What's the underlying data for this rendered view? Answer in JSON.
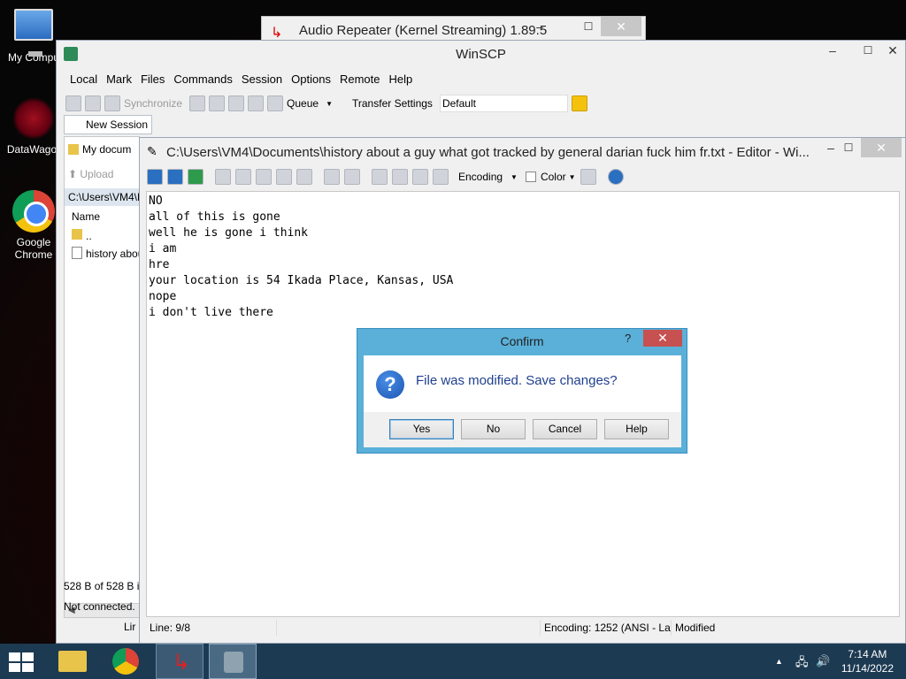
{
  "desktop": {
    "icons": [
      {
        "label": "My Compu"
      },
      {
        "label": "DataWagor"
      },
      {
        "label": "Google\nChrome"
      }
    ]
  },
  "audio_window": {
    "title": "Audio Repeater (Kernel Streaming) 1.89.5",
    "minimize": "–",
    "maximize": "☐",
    "close": "✕"
  },
  "winscp": {
    "title": "WinSCP",
    "minimize": "–",
    "maximize": "☐",
    "close": "✕",
    "menu": [
      "Local",
      "Mark",
      "Files",
      "Commands",
      "Session",
      "Options",
      "Remote",
      "Help"
    ],
    "toolbar": {
      "synchronize": "Synchronize",
      "queue": "Queue",
      "transfer_settings": "Transfer Settings",
      "transfer_value": "Default"
    },
    "new_session_tab": "New Session",
    "left_panel": {
      "location": "My docum",
      "upload": "Upload",
      "path": "C:\\Users\\VM4\\D",
      "column_name": "Name",
      "rows": [
        "..",
        "history abou"
      ]
    },
    "status": {
      "size": "528 B of 528 B ir",
      "connection": "Not connected."
    }
  },
  "editor": {
    "title": "C:\\Users\\VM4\\Documents\\history about a guy what got tracked by general darian fuck him fr.txt - Editor - Wi...",
    "minimize": "–",
    "maximize": "☐",
    "close": "✕",
    "toolbar": {
      "encoding": "Encoding",
      "color": "Color"
    },
    "lines": [
      "NO",
      "all of this is gone",
      "well he is gone i think",
      "i am",
      "hre",
      "your location is 54 Ikada Place, Kansas, USA",
      "nope",
      "i don't live there"
    ],
    "status": {
      "line": "Line: 9/8",
      "encoding": "Encoding: 1252  (ANSI - La",
      "modified": "Modified",
      "behind": "Lir"
    }
  },
  "dialog": {
    "title": "Confirm",
    "help_glyph": "?",
    "close": "✕",
    "message": "File was modified. Save changes?",
    "buttons": {
      "yes": "Yes",
      "no": "No",
      "cancel": "Cancel",
      "help": "Help"
    }
  },
  "taskbar": {
    "time": "7:14 AM",
    "date": "11/14/2022"
  }
}
